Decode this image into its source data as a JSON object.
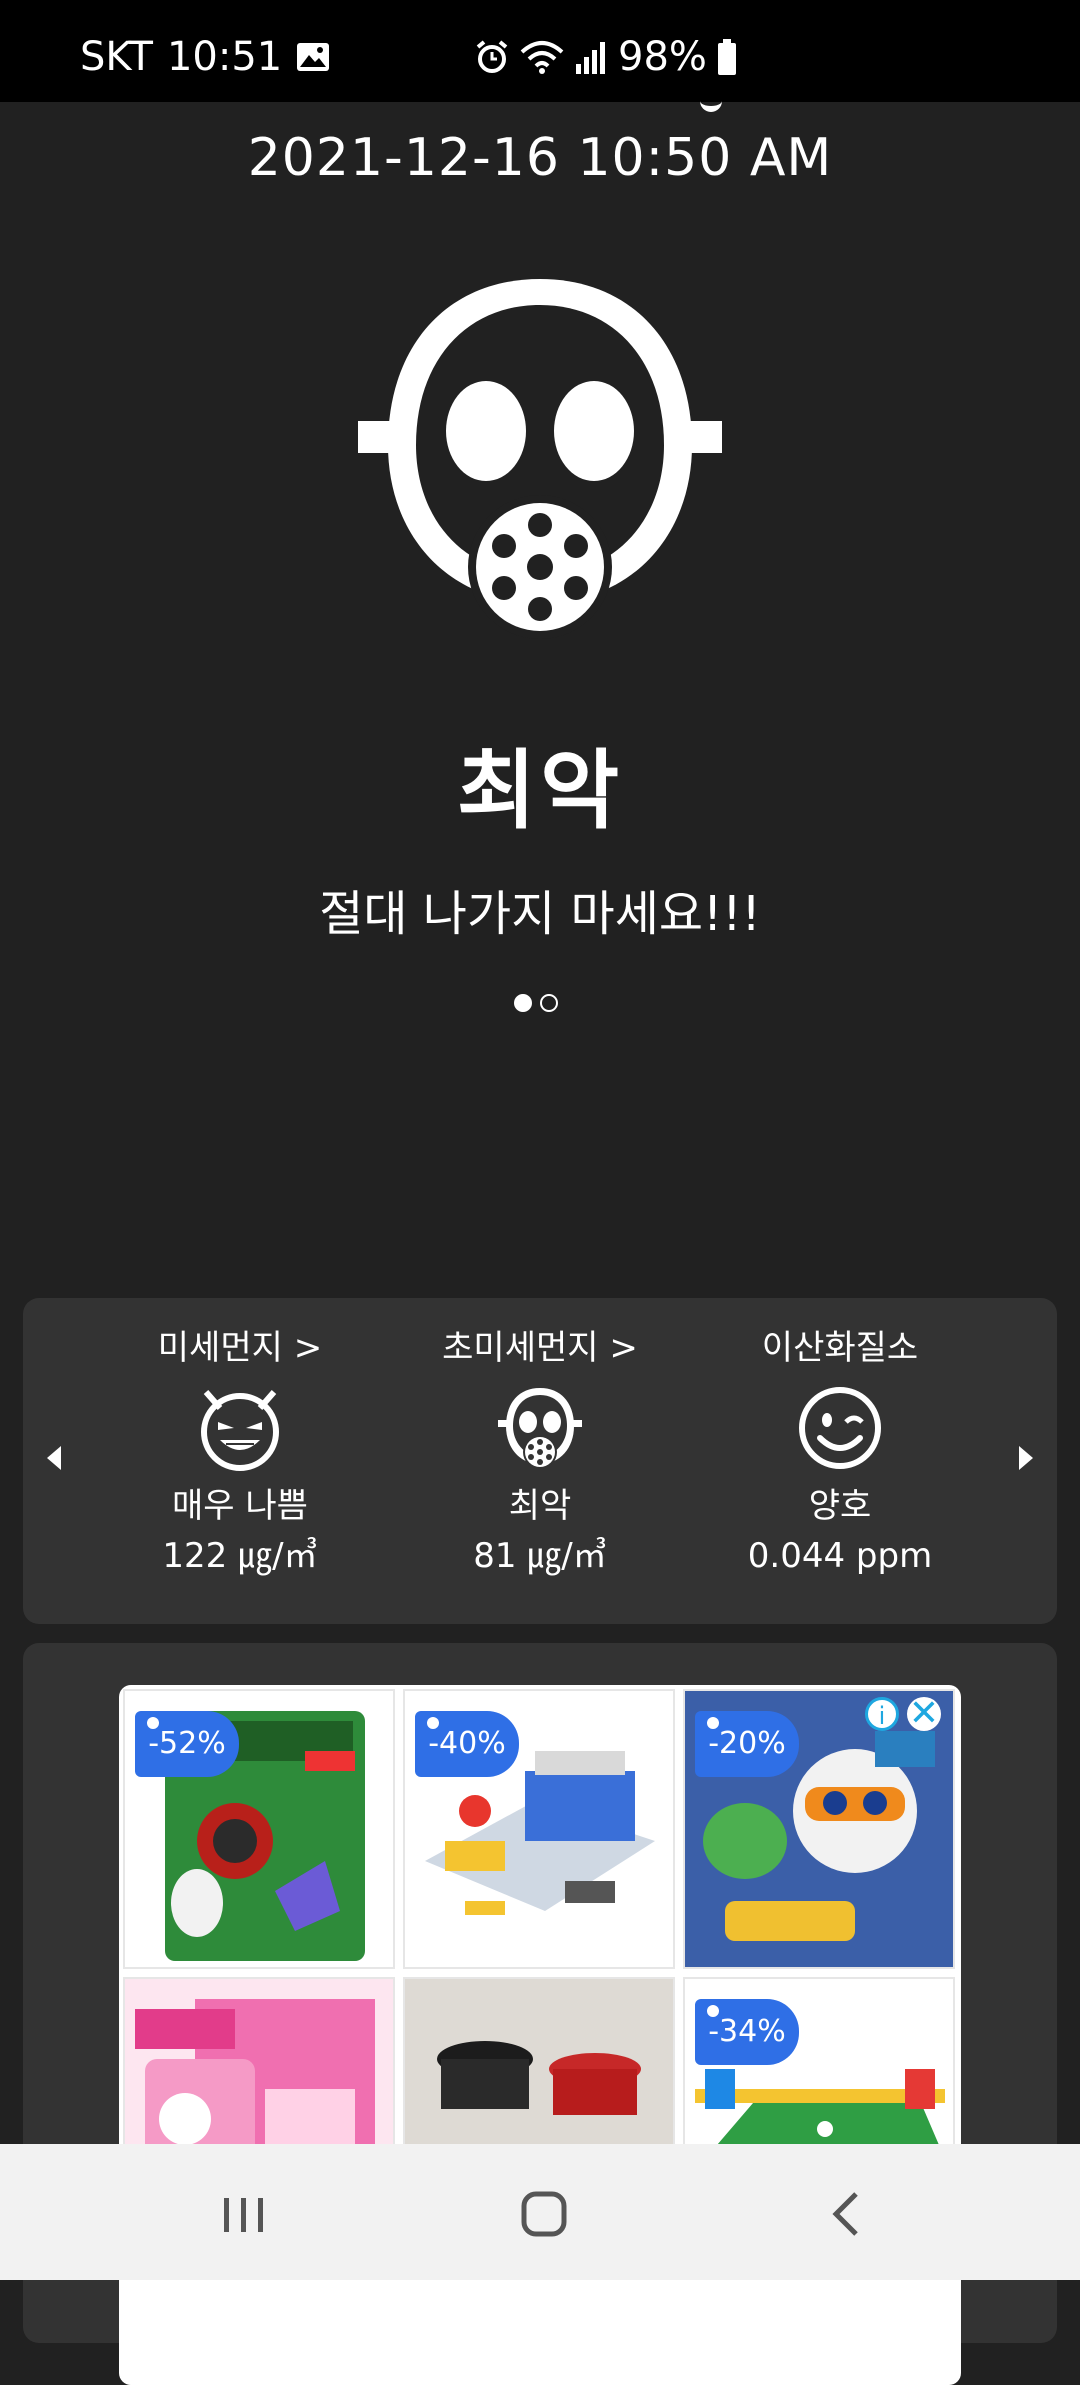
{
  "status_bar": {
    "carrier": "SKT",
    "time": "10:51",
    "battery": "98%",
    "icons": [
      "gallery-icon",
      "alarm-icon",
      "wifi-icon",
      "signal-icon",
      "battery-icon"
    ]
  },
  "header": {
    "datetime": "2021-12-16 10:50 AM"
  },
  "hero": {
    "icon": "gas-mask-icon",
    "level": "최악",
    "message": "절대 나가지 마세요!!!"
  },
  "pager": {
    "total": 2,
    "active": 1
  },
  "metrics": [
    {
      "title": "미세먼지 >",
      "icon": "devil-face-icon",
      "status": "매우 나쁨",
      "value": "122 ㎍/㎥"
    },
    {
      "title": "초미세먼지 >",
      "icon": "gas-mask-icon",
      "status": "최악",
      "value": "81 ㎍/㎥"
    },
    {
      "title": "이산화질소",
      "icon": "wink-face-icon",
      "status": "양호",
      "value": "0.044 ppm"
    }
  ],
  "ad": {
    "tiles": [
      {
        "discount": "-52%"
      },
      {
        "discount": "-40%"
      },
      {
        "discount": "-20%"
      },
      {
        "discount": ""
      },
      {
        "discount": ""
      },
      {
        "discount": "-34%"
      }
    ],
    "adchoice": "i",
    "close": "✕"
  },
  "colors": {
    "background": "#212121",
    "card": "#333333",
    "badge": "#2f6fe6"
  }
}
